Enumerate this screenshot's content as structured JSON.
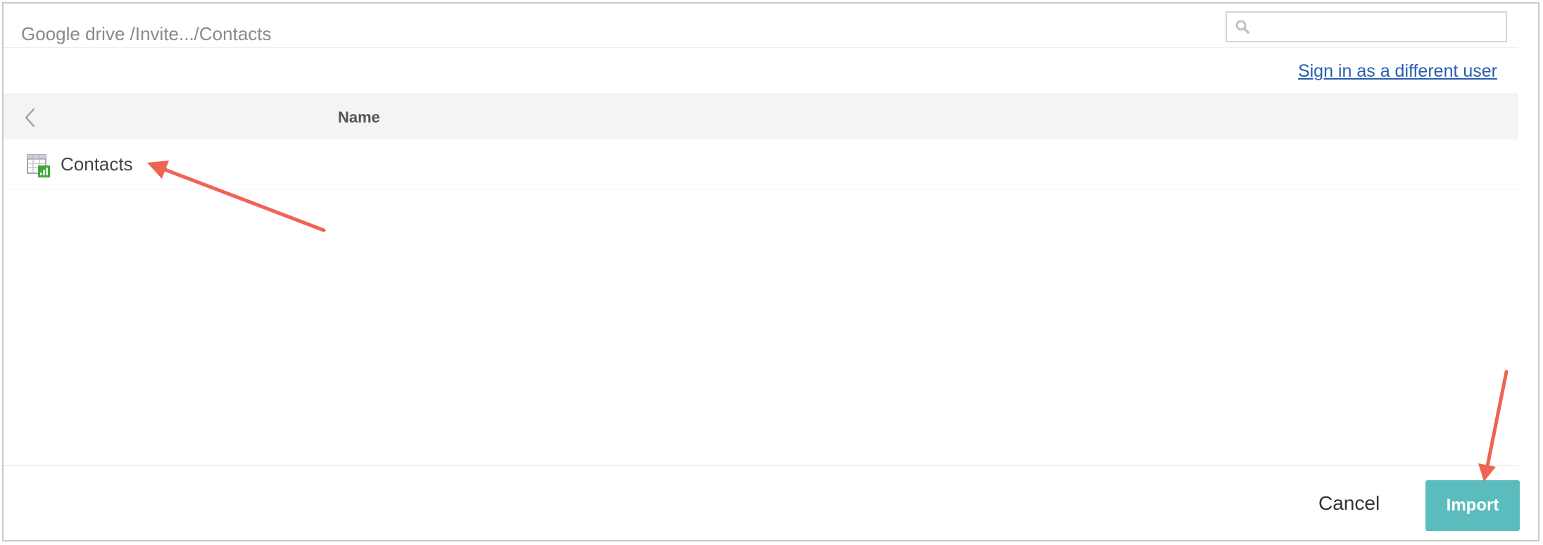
{
  "header": {
    "breadcrumb": "Google drive /Invite.../Contacts",
    "search_placeholder": "",
    "search_icon": "search-icon"
  },
  "account": {
    "signin_link": "Sign in as a different user"
  },
  "table": {
    "back_icon": "chevron-left-icon",
    "columns": [
      "Name"
    ],
    "rows": [
      {
        "name": "Contacts",
        "icon": "spreadsheet-icon"
      }
    ]
  },
  "footer": {
    "cancel_label": "Cancel",
    "import_label": "Import"
  },
  "colors": {
    "accent": "#5bbcbe",
    "link": "#2a5db0",
    "annotation_arrow": "#f06352"
  }
}
